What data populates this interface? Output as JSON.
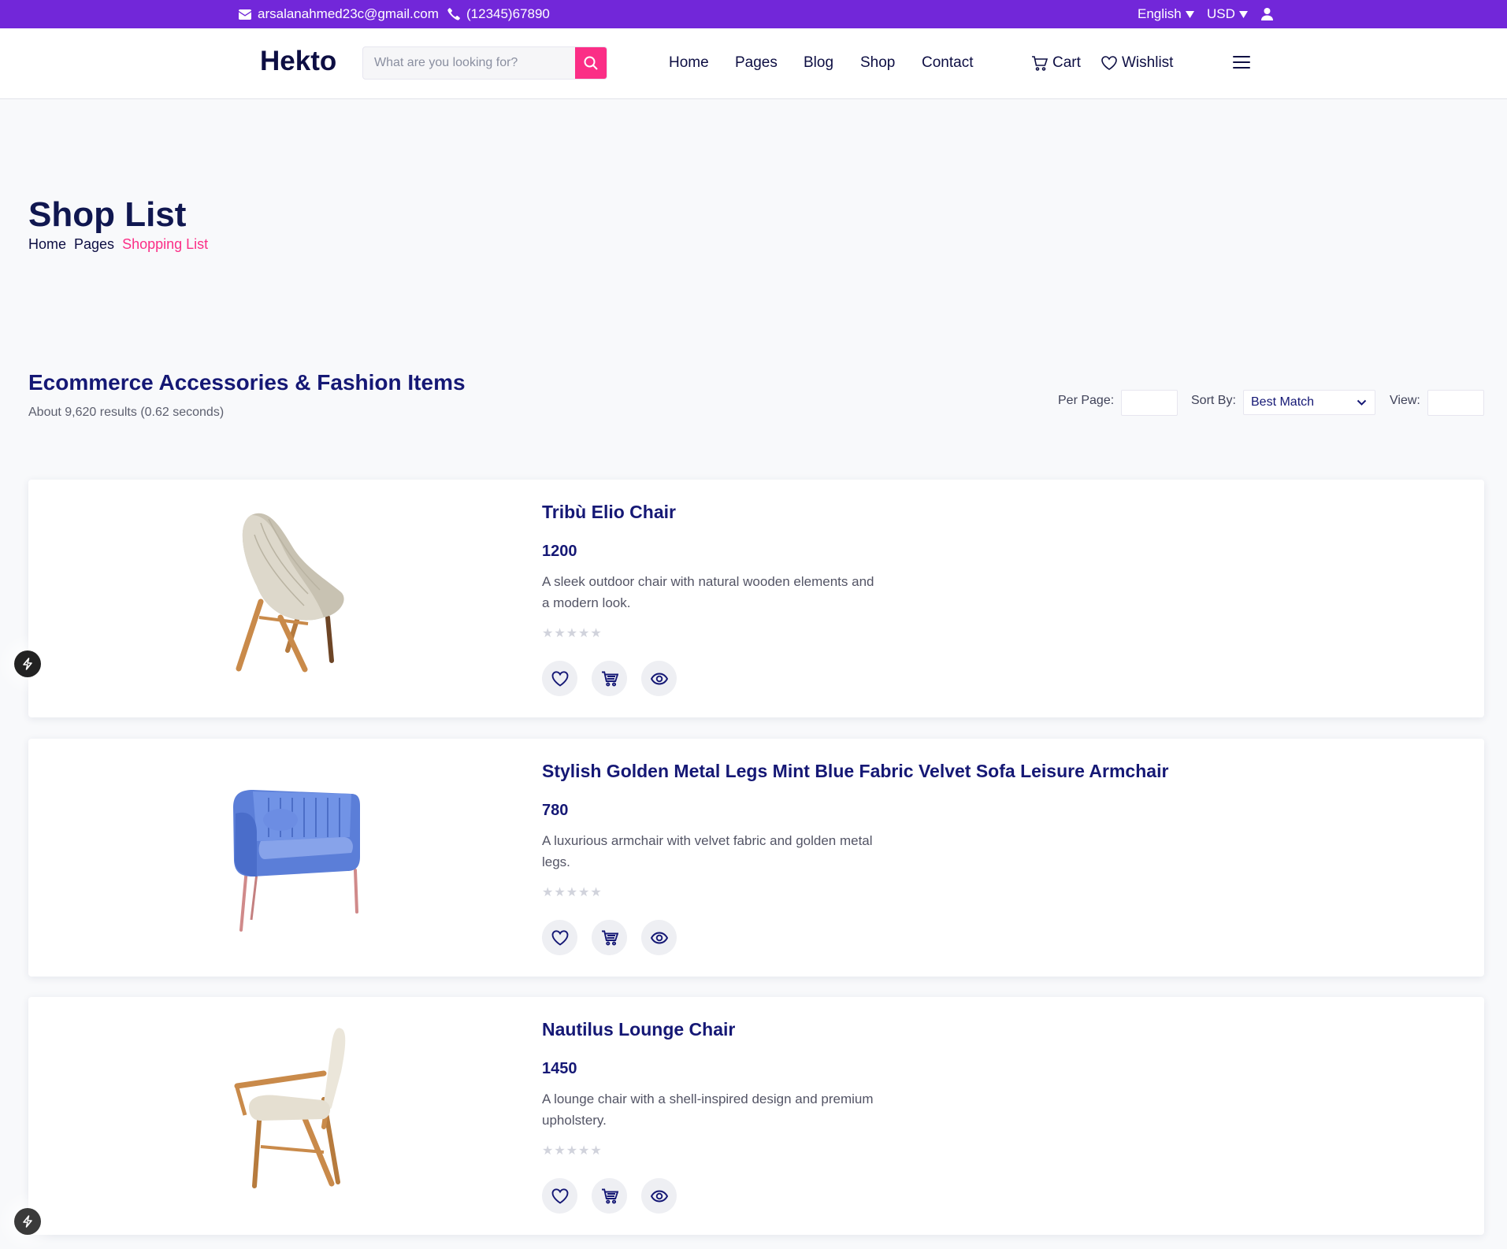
{
  "topbar": {
    "email": "arsalanahmed23c@gmail.com",
    "phone": "(12345)67890",
    "language": "English",
    "currency": "USD"
  },
  "header": {
    "logo": "Hekto",
    "search_placeholder": "What are you looking for?",
    "nav": [
      "Home",
      "Pages",
      "Blog",
      "Shop",
      "Contact"
    ],
    "cart_label": "Cart",
    "wishlist_label": "Wishlist"
  },
  "page": {
    "title": "Shop List",
    "breadcrumb": [
      "Home",
      "Pages",
      "Shopping List"
    ]
  },
  "toolbar": {
    "heading": "Ecommerce Accessories & Fashion Items",
    "results": "About 9,620 results (0.62 seconds)",
    "per_page_label": "Per Page:",
    "sort_label": "Sort By:",
    "sort_value": "Best Match",
    "view_label": "View:"
  },
  "products": [
    {
      "name": "Tribù Elio Chair",
      "price": "1200",
      "description": "A sleek outdoor chair with natural wooden elements and a modern look.",
      "rating": 0
    },
    {
      "name": "Stylish Golden Metal Legs Mint Blue Fabric Velvet Sofa Leisure Armchair",
      "price": "780",
      "description": "A luxurious armchair with velvet fabric and golden metal legs.",
      "rating": 0
    },
    {
      "name": "Nautilus Lounge Chair",
      "price": "1450",
      "description": "A lounge chair with a shell-inspired design and premium upholstery.",
      "rating": 0
    }
  ],
  "colors": {
    "topbar": "#7227d9",
    "accent": "#fb2e86",
    "navy": "#151875"
  }
}
